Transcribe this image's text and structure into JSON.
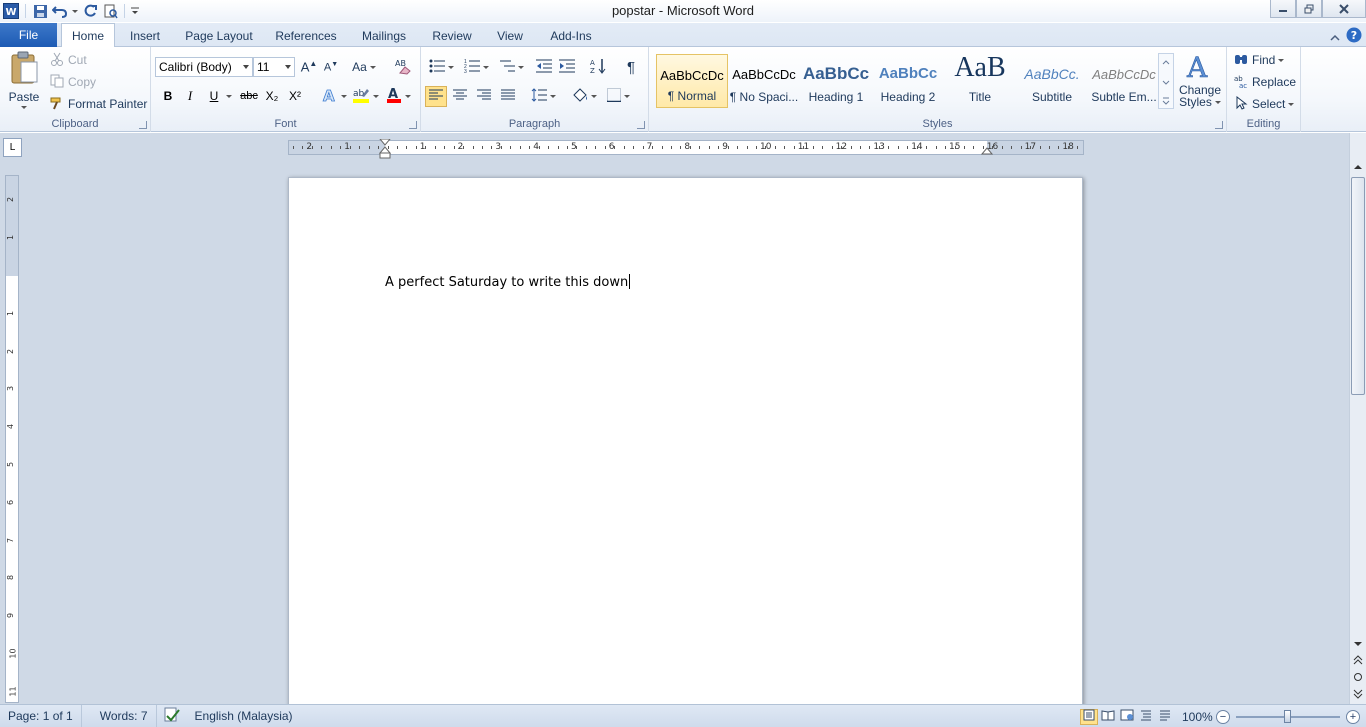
{
  "window": {
    "title": "popstar  -  Microsoft Word"
  },
  "tabs": [
    {
      "label": "File"
    },
    {
      "label": "Home"
    },
    {
      "label": "Insert"
    },
    {
      "label": "Page Layout"
    },
    {
      "label": "References"
    },
    {
      "label": "Mailings"
    },
    {
      "label": "Review"
    },
    {
      "label": "View"
    },
    {
      "label": "Add-Ins"
    }
  ],
  "clipboard": {
    "paste": "Paste",
    "cut": "Cut",
    "copy": "Copy",
    "format_painter": "Format Painter",
    "group_label": "Clipboard"
  },
  "font": {
    "name": "Calibri (Body)",
    "size": "11",
    "change_case": "Aa",
    "bold": "B",
    "italic": "I",
    "underline": "U",
    "strikethrough": "abc",
    "subscript": "X₂",
    "superscript": "X²",
    "group_label": "Font"
  },
  "paragraph": {
    "group_label": "Paragraph",
    "pilcrow": "¶"
  },
  "styles": {
    "group_label": "Styles",
    "items": [
      {
        "sample": "AaBbCcDc",
        "name": "¶ Normal"
      },
      {
        "sample": "AaBbCcDc",
        "name": "¶ No Spaci..."
      },
      {
        "sample": "AaBbCc",
        "name": "Heading 1"
      },
      {
        "sample": "AaBbCc",
        "name": "Heading 2"
      },
      {
        "sample": "AaB",
        "name": "Title"
      },
      {
        "sample": "AaBbCc.",
        "name": "Subtitle"
      },
      {
        "sample": "AaBbCcDc",
        "name": "Subtle Em..."
      }
    ],
    "change_styles_line1": "Change",
    "change_styles_line2": "Styles"
  },
  "editing": {
    "find": "Find",
    "replace": "Replace",
    "select": "Select",
    "group_label": "Editing"
  },
  "ruler": {
    "corner": "L",
    "numbers": [
      "2",
      "1",
      "1",
      "2",
      "3",
      "4",
      "5",
      "6",
      "7",
      "8",
      "9",
      "10",
      "11",
      "12",
      "13",
      "14",
      "15",
      "16",
      "17",
      "18"
    ],
    "vnumbers": [
      "2",
      "1",
      "1",
      "2",
      "3",
      "4",
      "5",
      "6",
      "7",
      "8",
      "9",
      "10",
      "11"
    ]
  },
  "document": {
    "text": "A perfect Saturday to write this down"
  },
  "statusbar": {
    "page": "Page: 1 of 1",
    "words": "Words: 7",
    "language": "English (Malaysia)",
    "zoom": "100%",
    "zoom_level": 1.0
  },
  "colors": {
    "file_tab": "#2b6bc3",
    "highlight": "#ffff00",
    "font_color": "#ff0000",
    "selected_style": "#ffe9a8"
  }
}
